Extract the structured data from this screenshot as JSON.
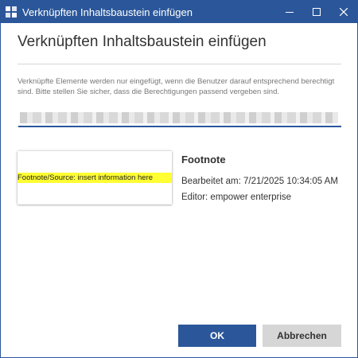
{
  "window": {
    "title": "Verknüpften Inhaltsbaustein einfügen",
    "accent_color": "#2b579a",
    "controls": {
      "minimize_icon": "minimize-icon",
      "maximize_icon": "maximize-icon",
      "close_icon": "close-icon"
    }
  },
  "dialog": {
    "title": "Verknüpften Inhaltsbaustein einfügen",
    "info": "Verknüpfte Elemente werden nur eingefügt, wenn die Benutzer darauf entsprechend berechtigt sind. Bitte stellen Sie sicher, dass die Berechtigungen passend vergeben sind.",
    "search": {
      "value": "",
      "obscured": true
    }
  },
  "item": {
    "preview_text": "Footnote/Source: insert information here",
    "preview_highlight_color": "#ffff33",
    "name": "Footnote",
    "edited": "Bearbeitet am: 7/21/2025 10:34:05 AM",
    "editor": "Editor: empower enterprise"
  },
  "buttons": {
    "ok": "OK",
    "cancel": "Abbrechen"
  }
}
